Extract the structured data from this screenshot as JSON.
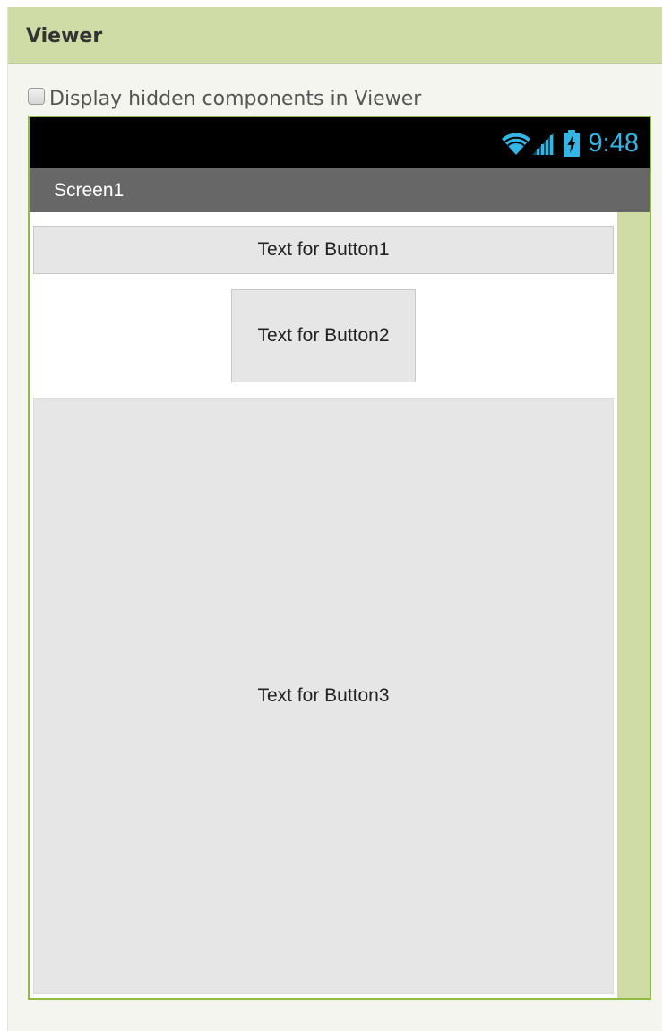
{
  "panel": {
    "title": "Viewer"
  },
  "options": {
    "display_hidden_label": "Display hidden components in Viewer",
    "display_hidden_checked": false
  },
  "phone": {
    "status_bar": {
      "time": "9:48",
      "icons": [
        "wifi-icon",
        "signal-icon",
        "battery-charging-icon"
      ],
      "accent_color": "#33b5e5"
    },
    "screen_title": "Screen1",
    "buttons": [
      {
        "label": "Text for Button1"
      },
      {
        "label": "Text for Button2"
      },
      {
        "label": "Text for Button3"
      }
    ]
  },
  "colors": {
    "header_bg": "#d0dca5",
    "phone_border": "#8fbb40",
    "title_bar_bg": "#676767",
    "button_bg": "#e6e6e6"
  }
}
